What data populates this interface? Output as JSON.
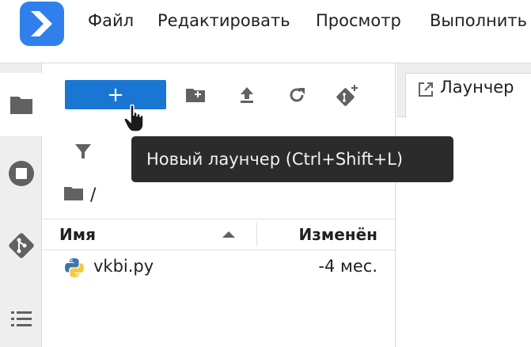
{
  "menu": {
    "items": [
      "Файл",
      "Редактировать",
      "Просмотр",
      "Выполнить"
    ]
  },
  "activity_bar": {
    "icons": [
      "folder-icon",
      "running-icon",
      "git-icon",
      "toc-icon"
    ]
  },
  "file_browser": {
    "new_launcher_label": "+",
    "toolbar_icons": [
      "new-folder-icon",
      "upload-icon",
      "refresh-icon",
      "new-git-icon"
    ],
    "breadcrumb_sep": "/",
    "columns": {
      "name": "Имя",
      "modified": "Изменён"
    },
    "files": [
      {
        "name": "vkbi.py",
        "modified": "-4 мес.",
        "icon": "python-icon"
      }
    ]
  },
  "tabs": [
    {
      "label": "Лаунчер",
      "icon": "launcher-icon"
    }
  ],
  "tooltip": {
    "text": "Новый лаунчер (Ctrl+Shift+L)"
  },
  "colors": {
    "accent": "#1976d2",
    "logo": "#2f80ed",
    "tooltip_bg": "#2b2b2b",
    "python_blue": "#3a75b0",
    "python_yellow": "#f5c93e"
  }
}
